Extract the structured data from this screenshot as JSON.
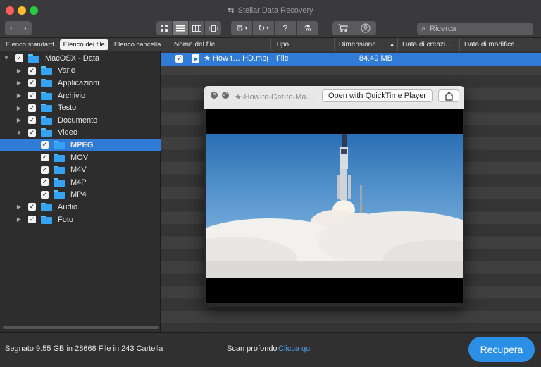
{
  "window": {
    "title": "Stellar Data Recovery"
  },
  "toolbar": {
    "back_icon": "chevron-left-icon",
    "forward_icon": "chevron-right-icon",
    "view_modes": [
      "grid-view-icon",
      "list-view-icon",
      "column-view-icon",
      "coverflow-view-icon"
    ],
    "active_view": "list-view-icon",
    "search_placeholder": "Ricerca"
  },
  "left_panel": {
    "tabs": [
      {
        "label": "Elenco standard",
        "active": false
      },
      {
        "label": "Elenco dei file",
        "active": true
      },
      {
        "label": "Elenco cancellato",
        "active": false
      }
    ],
    "tree": [
      {
        "label": "MacOSX - Data",
        "level": 0,
        "expanded": true,
        "checked": true,
        "selected": false
      },
      {
        "label": "Varie",
        "level": 1,
        "expanded": false,
        "checked": true,
        "selected": false
      },
      {
        "label": "Applicazioni",
        "level": 1,
        "expanded": false,
        "checked": true,
        "selected": false
      },
      {
        "label": "Archivio",
        "level": 1,
        "expanded": false,
        "checked": true,
        "selected": false
      },
      {
        "label": "Testo",
        "level": 1,
        "expanded": false,
        "checked": true,
        "selected": false
      },
      {
        "label": "Documento",
        "level": 1,
        "expanded": false,
        "checked": true,
        "selected": false
      },
      {
        "label": "Video",
        "level": 1,
        "expanded": true,
        "checked": true,
        "selected": false
      },
      {
        "label": "MPEG",
        "level": 2,
        "expanded": null,
        "checked": true,
        "selected": true
      },
      {
        "label": "MOV",
        "level": 2,
        "expanded": null,
        "checked": true,
        "selected": false
      },
      {
        "label": "M4V",
        "level": 2,
        "expanded": null,
        "checked": true,
        "selected": false
      },
      {
        "label": "M4P",
        "level": 2,
        "expanded": null,
        "checked": true,
        "selected": false
      },
      {
        "label": "MP4",
        "level": 2,
        "expanded": null,
        "checked": true,
        "selected": false
      },
      {
        "label": "Audio",
        "level": 1,
        "expanded": false,
        "checked": true,
        "selected": false
      },
      {
        "label": "Foto",
        "level": 1,
        "expanded": false,
        "checked": true,
        "selected": false
      }
    ]
  },
  "file_table": {
    "columns": [
      "Nome del file",
      "Tipo",
      "Dimensione",
      "Data di creazi...",
      "Data di modifica"
    ],
    "sort_column": "Dimensione",
    "rows": [
      {
        "name": "★ How t… HD.mpg",
        "type": "File",
        "size": "84.49 MB",
        "created": "",
        "modified": "",
        "checked": true
      }
    ]
  },
  "preview": {
    "title": "★-How-to-Get-to-Ma…",
    "open_button": "Open with QuickTime Player"
  },
  "status_bar": {
    "summary": "Segnato 9.55 GB in 28668 File in 243 Cartella",
    "deep_scan_label": "Scan profondo",
    "deep_scan_link": "Clicca qui",
    "recover_button": "Recupera"
  },
  "colors": {
    "selection": "#2f7bd6",
    "folder": "#36a3f2",
    "recover_button": "#2c8fe6",
    "link": "#4c9ce8"
  }
}
